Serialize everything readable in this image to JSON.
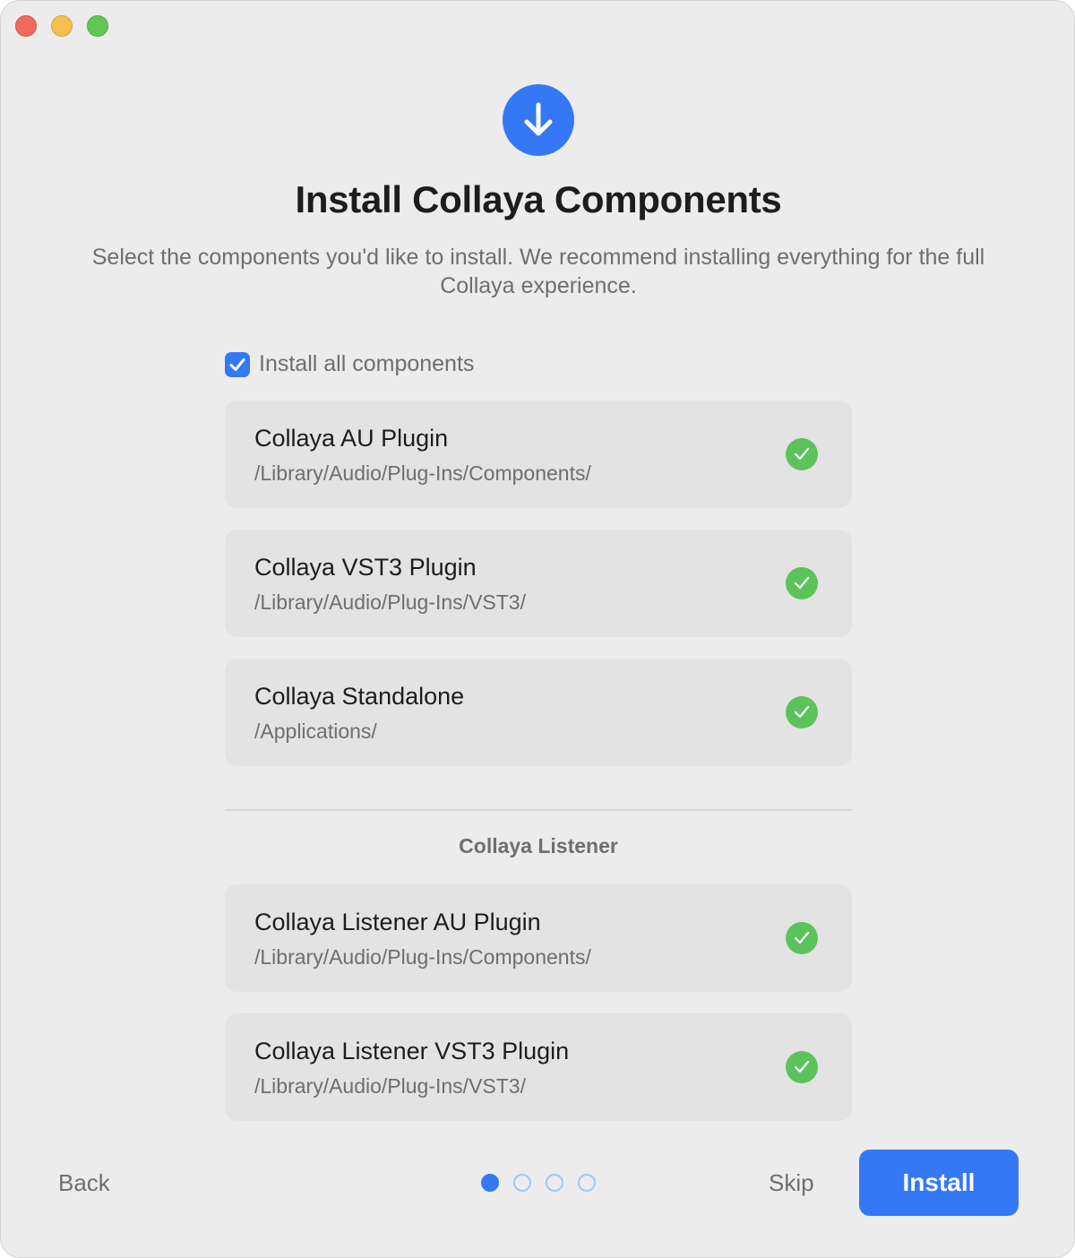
{
  "window": {
    "controls": [
      "close",
      "minimize",
      "zoom"
    ]
  },
  "header": {
    "icon": "download-arrow-icon",
    "title": "Install Collaya Components",
    "subtitle": "Select the components you'd like to install. We recommend installing everything for the full Collaya experience."
  },
  "install_all": {
    "label": "Install all components",
    "checked": true
  },
  "components": [
    {
      "name": "Collaya AU Plugin",
      "path": "/Library/Audio/Plug-Ins/Components/",
      "selected": true
    },
    {
      "name": "Collaya VST3 Plugin",
      "path": "/Library/Audio/Plug-Ins/VST3/",
      "selected": true
    },
    {
      "name": "Collaya Standalone",
      "path": "/Applications/",
      "selected": true
    }
  ],
  "listener_section": {
    "label": "Collaya Listener",
    "components": [
      {
        "name": "Collaya Listener AU Plugin",
        "path": "/Library/Audio/Plug-Ins/Components/",
        "selected": true
      },
      {
        "name": "Collaya Listener VST3 Plugin",
        "path": "/Library/Audio/Plug-Ins/VST3/",
        "selected": true
      }
    ]
  },
  "footer": {
    "back_label": "Back",
    "skip_label": "Skip",
    "install_label": "Install",
    "pager": {
      "total": 4,
      "current": 1
    }
  },
  "colors": {
    "accent": "#3478f6",
    "success": "#5cc35a",
    "background": "#ececec",
    "card": "#e3e3e3"
  }
}
